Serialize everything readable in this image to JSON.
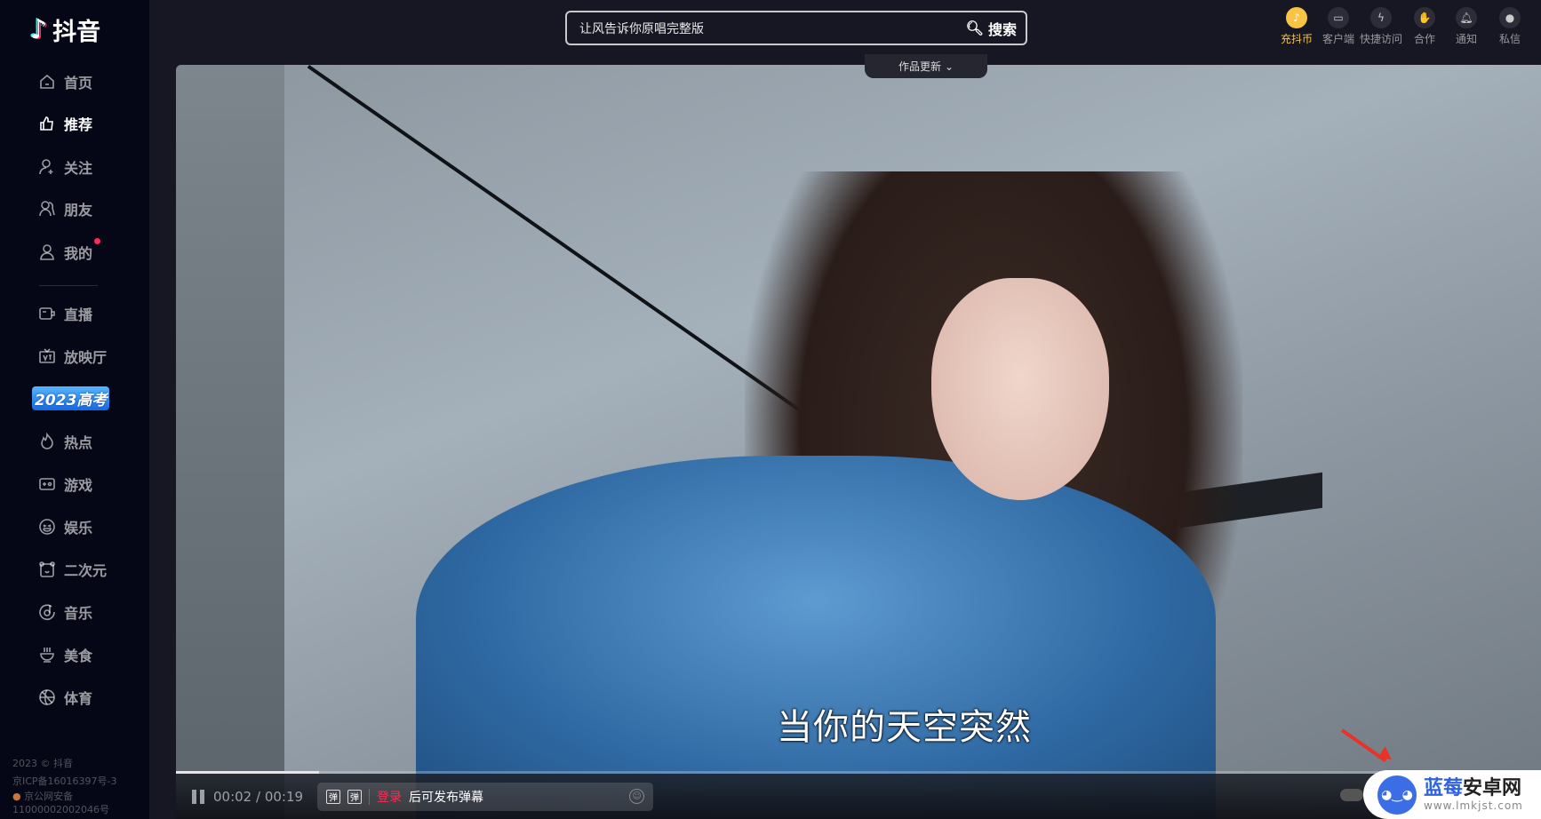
{
  "app": {
    "logo_text": "抖音"
  },
  "sidebar": {
    "items": [
      {
        "label": "首页",
        "icon": "home-icon"
      },
      {
        "label": "推荐",
        "icon": "thumbs-up-icon",
        "active": true
      },
      {
        "label": "关注",
        "icon": "user-plus-icon"
      },
      {
        "label": "朋友",
        "icon": "friends-icon"
      },
      {
        "label": "我的",
        "icon": "user-icon",
        "badge": true
      },
      {
        "label": "直播",
        "icon": "live-icon"
      },
      {
        "label": "放映厅",
        "icon": "tv-icon"
      },
      {
        "label": "2023高考",
        "icon": "banner"
      },
      {
        "label": "热点",
        "icon": "fire-icon"
      },
      {
        "label": "游戏",
        "icon": "gamepad-icon"
      },
      {
        "label": "娱乐",
        "icon": "smile-icon"
      },
      {
        "label": "二次元",
        "icon": "bear-icon"
      },
      {
        "label": "音乐",
        "icon": "music-icon"
      },
      {
        "label": "美食",
        "icon": "bowl-icon"
      },
      {
        "label": "体育",
        "icon": "ball-icon"
      }
    ],
    "footer": [
      "2023 © 抖音",
      "京ICP备16016397号-3",
      "京公网安备",
      "11000002002046号"
    ]
  },
  "search": {
    "value": "让风告诉你原唱完整版",
    "button": "搜索"
  },
  "update_tab": "作品更新",
  "toolbar": [
    {
      "label": "充抖币",
      "icon": "coin-icon",
      "highlight": "#f7c443"
    },
    {
      "label": "客户端",
      "icon": "desktop-icon"
    },
    {
      "label": "快捷访问",
      "icon": "lightning-icon"
    },
    {
      "label": "合作",
      "icon": "handshake-icon"
    },
    {
      "label": "通知",
      "icon": "bell-icon"
    },
    {
      "label": "私信",
      "icon": "message-icon"
    }
  ],
  "video": {
    "subtitle": "当你的天空突然",
    "current_time": "00:02",
    "duration": "00:19",
    "time_display": "00:02 / 00:19",
    "progress": 0.105
  },
  "danmaku": {
    "login_link": "登录",
    "hint": "后可发布弹幕",
    "icon1": "弹",
    "icon2": "弹"
  },
  "watermark": {
    "brand_a": "蓝莓",
    "brand_b": "安卓网",
    "url": "www.lmkjst.com"
  }
}
